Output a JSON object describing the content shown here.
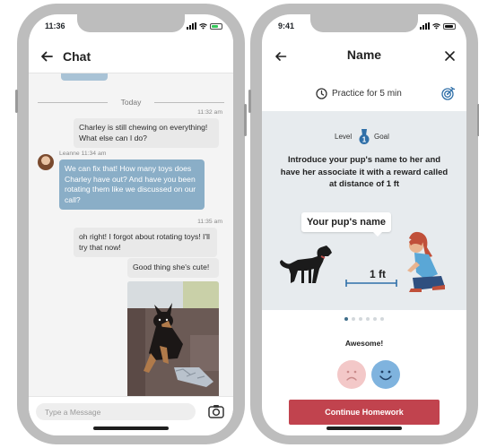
{
  "chat_screen": {
    "status_time": "11:36",
    "title": "Chat",
    "divider_label": "Today",
    "messages": [
      {
        "meta": "11:32 am",
        "text": "Charley is still chewing on everything! What else can I do?"
      },
      {
        "meta": "Leanne 11:34 am",
        "text": "We can fix that! How many toys does Charley have out? And have you been rotating them like we discussed on our call?"
      },
      {
        "meta": "11:35 am",
        "text": "oh right! I forgot about rotating toys! I'll try that now!"
      },
      {
        "text": "Good thing she's cute!"
      }
    ],
    "input_placeholder": "Type a Message"
  },
  "exercise_screen": {
    "status_time": "9:41",
    "title": "Name",
    "practice_text": "Practice for 5 min",
    "level_label": "Level",
    "level_value": "1",
    "goal_label": "Goal",
    "instruction": "Introduce your pup's name to her and have her associate it with a reward called at distance of 1 ft",
    "speech_label": "Your pup's name",
    "distance_label": "1 ft",
    "carousel": {
      "count": 6,
      "active_index": 0
    },
    "feedback_label": "Awesome!",
    "cta_label": "Continue Homework"
  },
  "colors": {
    "frame": "#bdbdbd",
    "incoming_bubble": "#8aaec7",
    "outgoing_bubble": "#e9e9e9",
    "panel": "#e7ebee",
    "cta": "#c1434e",
    "sad_face": "#f3c8c8",
    "happy_face": "#7fb3de"
  },
  "icons": [
    "back-arrow-icon",
    "close-icon",
    "clock-icon",
    "target-icon",
    "medal-icon",
    "camera-icon",
    "sad-face-icon",
    "happy-face-icon"
  ]
}
